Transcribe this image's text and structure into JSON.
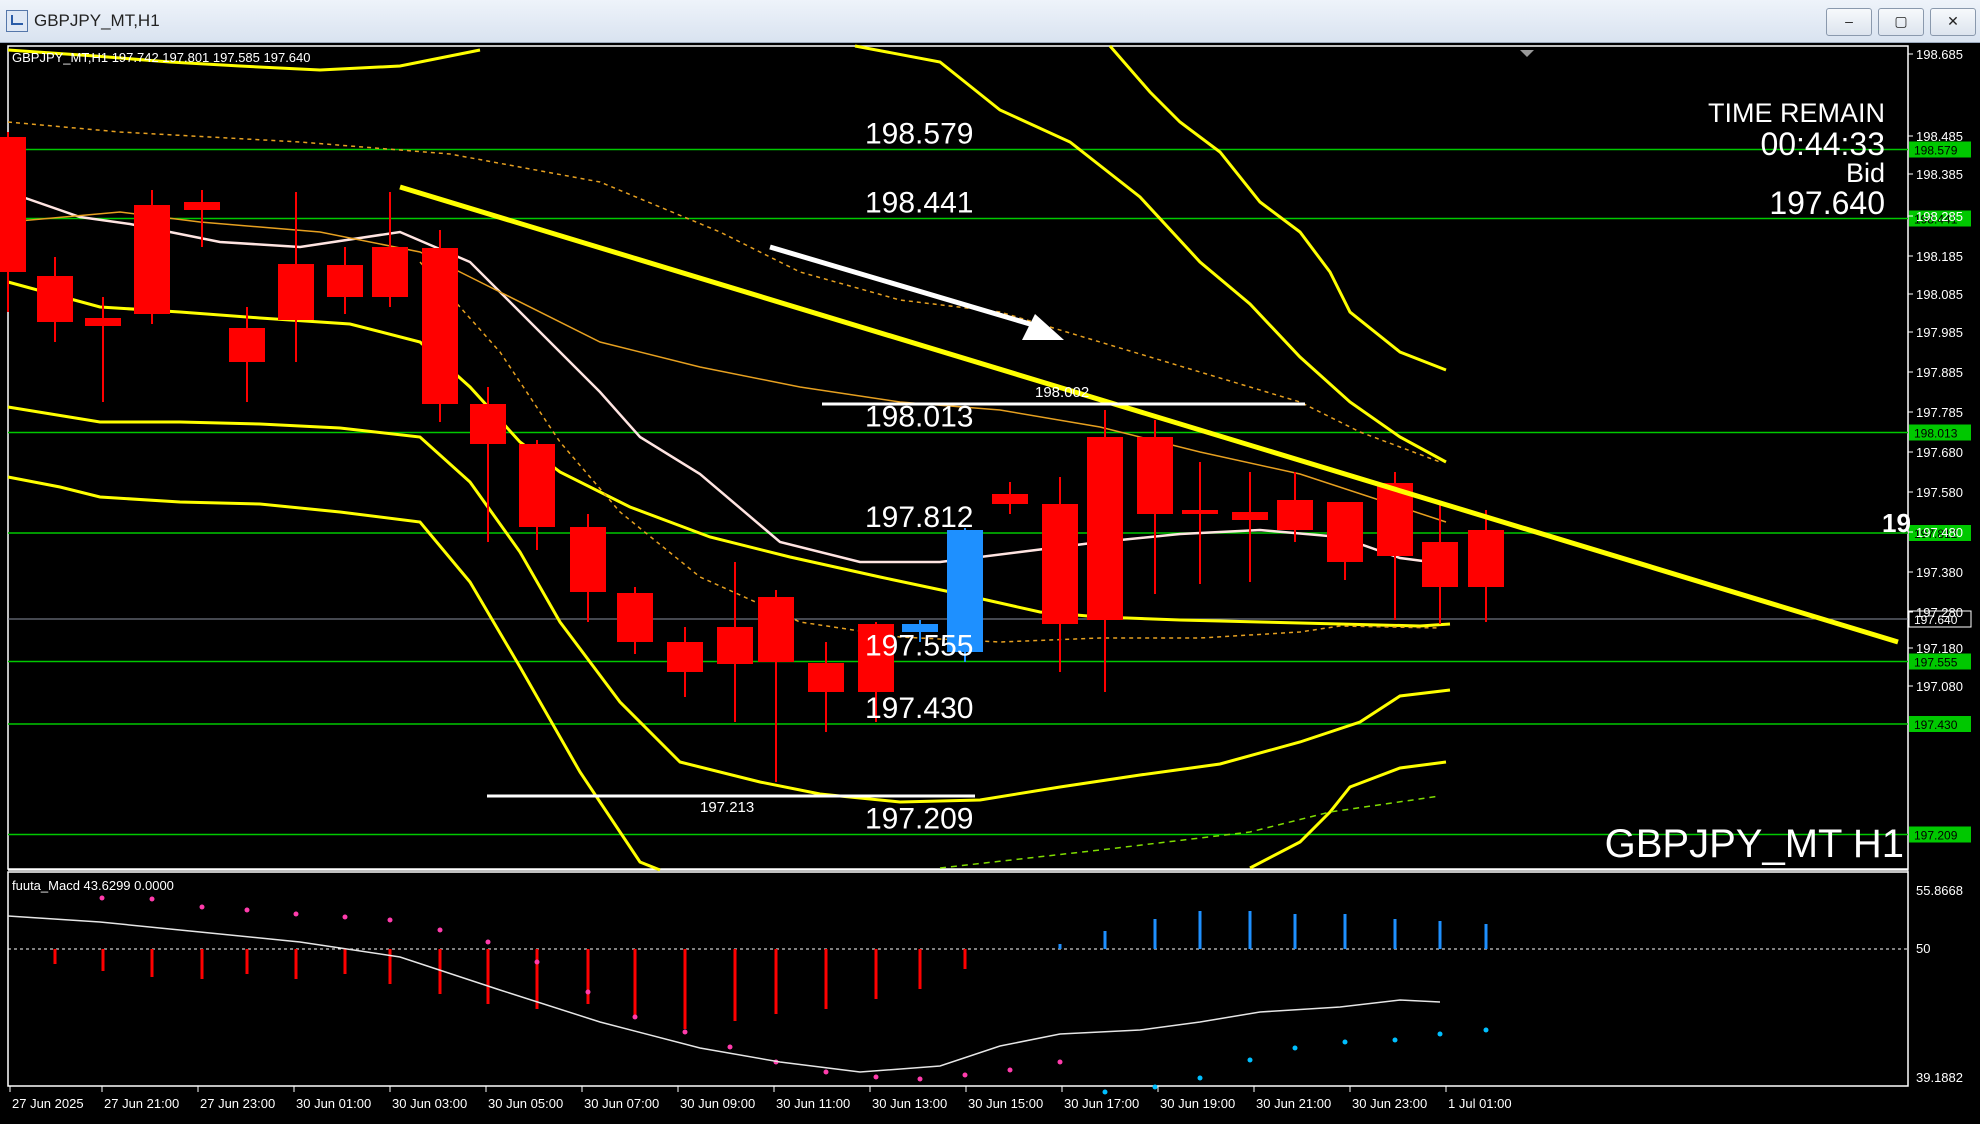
{
  "window": {
    "title": "GBPJPY_MT,H1",
    "minimize": "–",
    "maximize": "▢",
    "close": "✕"
  },
  "chart": {
    "info": "GBPJPY_MT,H1  197.742 197.801 197.585 197.640",
    "symbol_label": "GBPJPY_MT H1",
    "time_remain_label": "TIME REMAIN",
    "time_remain": "00:44:33",
    "bid_label": "Bid",
    "bid": "197.640",
    "cut_label": "19",
    "swing_high_label": "198.002",
    "swing_low_label": "197.213",
    "axis_ticks": [
      "198.685",
      "198.485",
      "198.385",
      "198.285",
      "198.185",
      "198.085",
      "197.985",
      "197.885",
      "197.785",
      "197.680",
      "197.580",
      "197.480",
      "197.380",
      "197.280",
      "197.180",
      "197.080"
    ],
    "levels": [
      {
        "price": 198.579,
        "label": "198.579",
        "tag": "198.579"
      },
      {
        "price": 198.441,
        "label": "198.441",
        "tag": "198.441"
      },
      {
        "price": 198.013,
        "label": "198.013",
        "tag": "198.013"
      },
      {
        "price": 197.812,
        "label": "197.812",
        "tag": "197.812"
      },
      {
        "price": 197.555,
        "label": "197.555",
        "tag": "197.555"
      },
      {
        "price": 197.43,
        "label": "197.430",
        "tag": "197.430"
      },
      {
        "price": 197.209,
        "label": "197.209",
        "tag": "197.209"
      }
    ],
    "current_price_tag": "197.640"
  },
  "macd": {
    "label": "fuuta_Macd 43.6299  0.0000",
    "ticks": [
      "55.8668",
      "50",
      "39.1882"
    ]
  },
  "time_axis": [
    "27 Jun 2025",
    "27 Jun 21:00",
    "27 Jun 23:00",
    "30 Jun 01:00",
    "30 Jun 03:00",
    "30 Jun 05:00",
    "30 Jun 07:00",
    "30 Jun 09:00",
    "30 Jun 11:00",
    "30 Jun 13:00",
    "30 Jun 15:00",
    "30 Jun 17:00",
    "30 Jun 19:00",
    "30 Jun 21:00",
    "30 Jun 23:00",
    "1 Jul 01:00"
  ],
  "colors": {
    "bull": "#1e90ff",
    "bear": "#ff0000",
    "level": "#00c800",
    "trend": "#ffff00",
    "band": "#ffff00",
    "ma": "#ffe4e1"
  }
}
